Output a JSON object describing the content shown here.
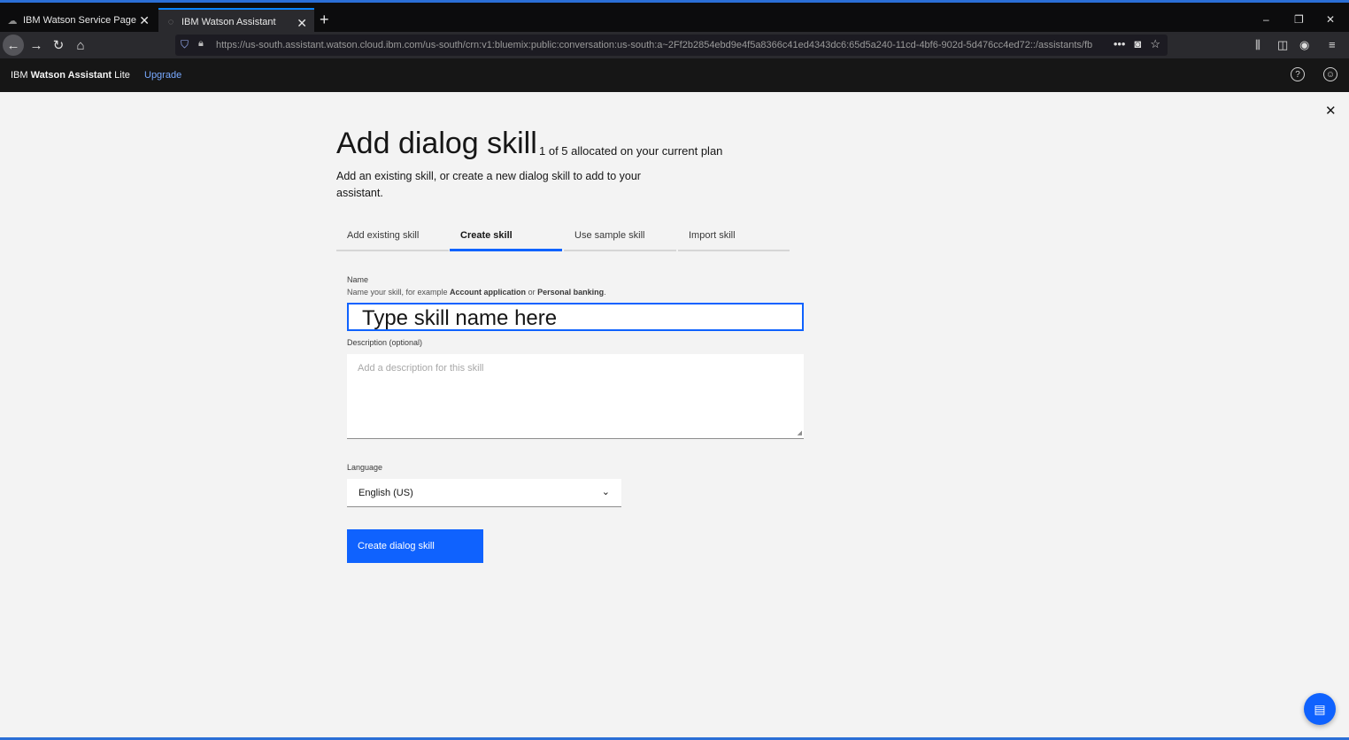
{
  "browser": {
    "tabs": [
      {
        "label": "IBM Watson Service Page",
        "close": "✕"
      },
      {
        "label": "IBM Watson Assistant",
        "close": "✕"
      }
    ],
    "new_tab": "+",
    "url": "https://us-south.assistant.watson.cloud.ibm.com/us-south/crn:v1:bluemix:public:conversation:us-south:a~2Ff2b2854ebd9e4f5a8366c41ed4343dc6:65d5a240-11cd-4bf6-902d-5d476cc4ed72::/assistants/fb",
    "window_controls": {
      "minimize": "–",
      "restore": "❐",
      "close": "✕"
    }
  },
  "header": {
    "brand_prefix": "IBM ",
    "brand_bold": "Watson Assistant",
    "brand_suffix": " Lite",
    "upgrade": "Upgrade",
    "help_icon": "?",
    "user_icon": "☺"
  },
  "page": {
    "close": "✕",
    "title": "Add dialog skill",
    "allocation": "1 of 5 allocated on your current plan",
    "intro": "Add an existing skill, or create a new dialog skill to add to your assistant.",
    "tabs": [
      {
        "label": "Add existing skill"
      },
      {
        "label": "Create skill"
      },
      {
        "label": "Use sample skill"
      },
      {
        "label": "Import skill"
      }
    ],
    "name_label": "Name",
    "name_helper_prefix": "Name your skill, for example ",
    "name_helper_bold1": "Account application",
    "name_helper_mid": " or ",
    "name_helper_bold2": "Personal banking",
    "name_helper_suffix": ".",
    "name_value": "Type skill name here",
    "description_label": "Description (optional)",
    "description_placeholder": "Add a description for this skill",
    "language_label": "Language",
    "language_value": "English (US)",
    "create_button": "Create dialog skill"
  },
  "colors": {
    "primary": "#0f62fe",
    "header_bg": "#161616",
    "page_bg": "#f3f3f3"
  }
}
